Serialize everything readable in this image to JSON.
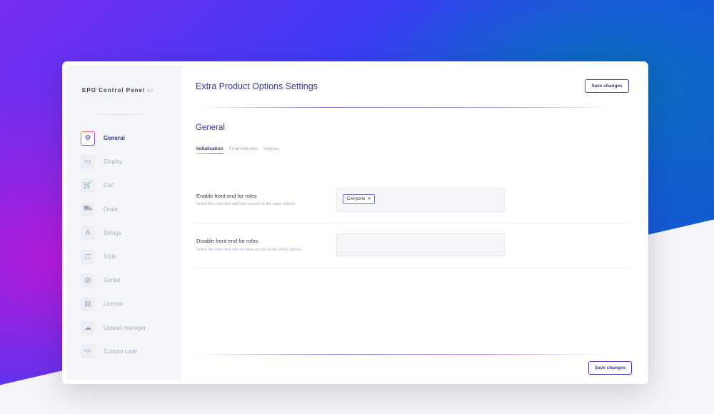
{
  "brand": {
    "name": "EPO Control Panel",
    "version": "6.0"
  },
  "sidebar": {
    "items": [
      {
        "label": "General",
        "icon": "⚙",
        "active": true
      },
      {
        "label": "Display",
        "icon": "▭"
      },
      {
        "label": "Cart",
        "icon": "🛒"
      },
      {
        "label": "Order",
        "icon": "⛟"
      },
      {
        "label": "Strings",
        "icon": "A"
      },
      {
        "label": "Style",
        "icon": "◻"
      },
      {
        "label": "Global",
        "icon": "◍"
      },
      {
        "label": "License",
        "icon": "▤"
      },
      {
        "label": "Upload manager",
        "icon": "☁"
      },
      {
        "label": "Custom code",
        "icon": "</>"
      }
    ]
  },
  "header": {
    "title": "Extra Product Options Settings",
    "save_label": "Save changes"
  },
  "section": {
    "title": "General",
    "tabs": [
      {
        "label": "Initialization",
        "active": true
      },
      {
        "label": "Final total box"
      },
      {
        "label": "Various"
      }
    ]
  },
  "fields": [
    {
      "label": "Enable front-end for roles",
      "description": "Select the roles that will have access to the extra options.",
      "chips": [
        {
          "label": "Everyone",
          "remove": "×"
        }
      ]
    },
    {
      "label": "Disable front-end for roles",
      "description": "Select the roles that will not have access to the extra options.",
      "chips": []
    }
  ],
  "footer": {
    "save_label": "Save changes"
  }
}
